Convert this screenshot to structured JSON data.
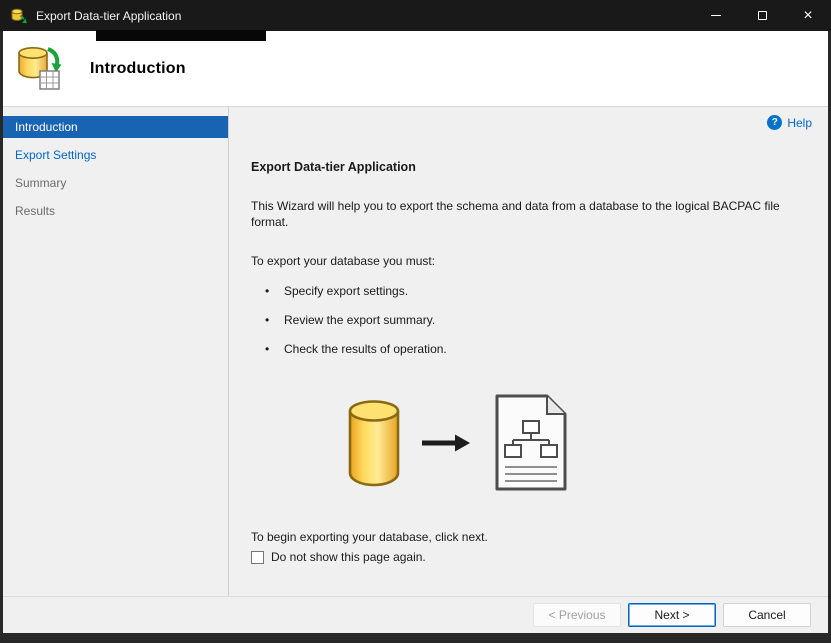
{
  "window": {
    "title": "Export Data-tier Application",
    "close_glyph": "×"
  },
  "header": {
    "title": "Introduction"
  },
  "sidebar": {
    "items": [
      {
        "label": "Introduction",
        "state": "selected"
      },
      {
        "label": "Export Settings",
        "state": "visited"
      },
      {
        "label": "Summary",
        "state": "pending"
      },
      {
        "label": "Results",
        "state": "pending"
      }
    ]
  },
  "content": {
    "help_label": "Help",
    "help_glyph": "?",
    "heading": "Export Data-tier Application",
    "intro": "This Wizard will help you to export the schema and data from a database to the logical BACPAC file format.",
    "must_label": "To export your database you must:",
    "bullets": [
      "Specify export settings.",
      "Review the export summary.",
      "Check the results of operation."
    ],
    "begin_text": "To begin exporting your database, click next.",
    "checkbox_label": "Do not show this page again.",
    "checkbox_checked": false
  },
  "footer": {
    "previous_label": "< Previous",
    "next_label": "Next >",
    "cancel_label": "Cancel"
  },
  "icons": {
    "app": "database-export-icon",
    "header": "database-export-icon",
    "help": "question-circle-icon",
    "graphic_left": "database-cylinder-icon",
    "graphic_middle": "right-arrow-icon",
    "graphic_right": "bacpac-document-icon"
  },
  "colors": {
    "titlebar_bg": "#191919",
    "frame": "#282828",
    "selected_bg": "#1863b2",
    "link_blue": "#0066cc",
    "help_blue": "#0173c7",
    "accent": "#0067c0",
    "panel_bg": "#f0f0f0",
    "header_bg": "#ffffff"
  }
}
